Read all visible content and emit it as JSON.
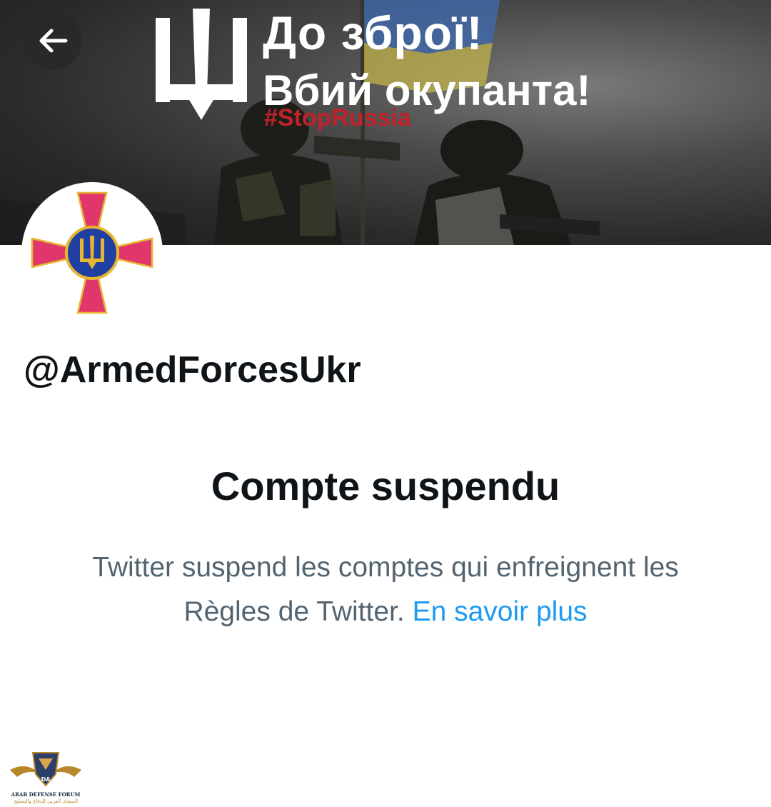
{
  "banner": {
    "line1": "До зброї!",
    "line2": "Вбий окупанта!",
    "hashtag": "#StopRussia"
  },
  "header": {
    "back_icon": "arrow-left-icon"
  },
  "profile": {
    "avatar_icon": "ukraine-armed-forces-emblem-icon",
    "handle": "@ArmedForcesUkr"
  },
  "suspension": {
    "title": "Compte suspendu",
    "message": "Twitter suspend les comptes qui enfreignent les Règles de Twitter. ",
    "link_label": "En savoir plus"
  },
  "watermark": {
    "logo_letters": "DA",
    "line1": "ARAB DEFENSE FORUM",
    "line2": "المنتدى العربي للدفاع والتسليح"
  },
  "colors": {
    "link": "#1d9bf0",
    "text_primary": "#0f1419",
    "text_secondary": "#536471",
    "hashtag": "#c0222a",
    "emblem_cross": "#e0366b",
    "emblem_blue": "#1f3fa3",
    "emblem_gold": "#e7b531"
  }
}
